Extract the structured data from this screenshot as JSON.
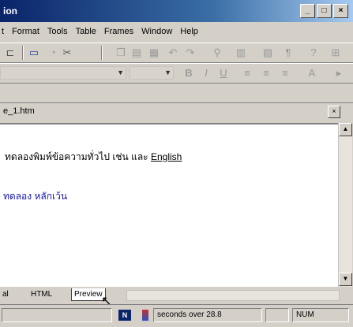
{
  "window": {
    "title": "ion",
    "buttons": {
      "minimize": "_",
      "maximize": "□",
      "close": "×"
    }
  },
  "menubar": {
    "items": [
      "t",
      "Format",
      "Tools",
      "Table",
      "Frames",
      "Window",
      "Help"
    ]
  },
  "toolbar": {
    "icons": [
      "link-icon",
      "hr-icon",
      "print-preview-icon",
      "cut-icon",
      "copy-icon",
      "paste-icon",
      "format-painter-icon",
      "undo-icon",
      "redo-icon",
      "hyperlink-icon",
      "table-icon",
      "frame-icon",
      "show-all-icon"
    ]
  },
  "formatting": {
    "icons": [
      "bold-icon",
      "italic-icon",
      "underline-icon",
      "align-left-icon",
      "align-center-icon",
      "align-right-icon",
      "font-color-icon"
    ]
  },
  "navigation": {
    "address": "e_1.htm"
  },
  "editor": {
    "line1_thai": "ทดลองพิมพ์ข้อความทั่วไป เช่น และ ",
    "line1_english": "English",
    "line2": "ทดลอง หลักเว้น"
  },
  "tabs": [
    {
      "label": "al",
      "active": false
    },
    {
      "label": "HTML",
      "active": false
    },
    {
      "label": "Preview",
      "active": true
    }
  ],
  "statusbar": {
    "lang": "N",
    "download_time": "seconds over 28.8",
    "mode": "NUM"
  }
}
